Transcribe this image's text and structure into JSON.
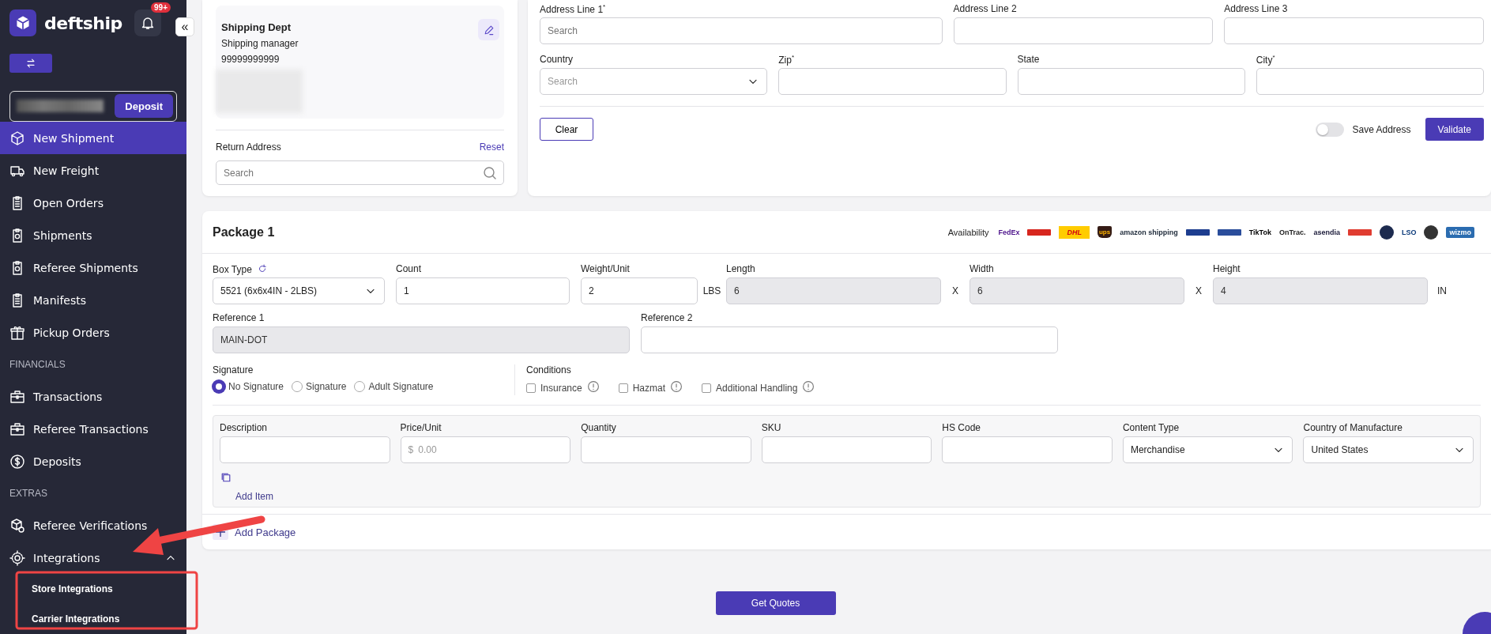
{
  "sidebar": {
    "brand": "deftship",
    "notification_count": "99+",
    "collapse_glyph": "«",
    "deposit_button": "Deposit",
    "sections": [
      {
        "items": [
          {
            "label": "New Shipment",
            "selected": true
          },
          {
            "label": "New Freight",
            "selected": false
          },
          {
            "label": "Open Orders",
            "selected": false
          },
          {
            "label": "Shipments",
            "selected": false
          },
          {
            "label": "Referee Shipments",
            "selected": false
          },
          {
            "label": "Manifests",
            "selected": false
          },
          {
            "label": "Pickup Orders",
            "selected": false
          }
        ]
      },
      {
        "heading": "FINANCIALS",
        "items": [
          {
            "label": "Transactions",
            "selected": false
          },
          {
            "label": "Referee Transactions",
            "selected": false
          },
          {
            "label": "Deposits",
            "selected": false
          }
        ]
      },
      {
        "heading": "EXTRAS",
        "items": [
          {
            "label": "Referee Verifications",
            "selected": false
          },
          {
            "label": "Integrations",
            "selected": false,
            "expanded": true,
            "children": [
              {
                "label": "Store Integrations",
                "selected": false
              },
              {
                "label": "Carrier Integrations",
                "selected": false
              }
            ]
          }
        ]
      }
    ]
  },
  "sender_card": {
    "name": "Shipping Dept",
    "title": "Shipping manager",
    "phone": "99999999999",
    "return_address_label": "Return Address",
    "reset_link": "Reset",
    "return_search_placeholder": "Search"
  },
  "address_form": {
    "address_lines": [
      {
        "label": "Address Line 1$^{*}$",
        "placeholder": "Search"
      },
      {
        "label": "Address Line 2"
      },
      {
        "label": "Address Line 3"
      }
    ],
    "location_fields": [
      {
        "label": "Country",
        "kind": "select",
        "placeholder": "Search"
      },
      {
        "label": "Zip$^{*}$",
        "kind": "text"
      },
      {
        "label": "State",
        "kind": "text"
      },
      {
        "label": "City$^{*}$",
        "kind": "text"
      }
    ],
    "clear_button": "Clear",
    "save_address": {
      "label": "Save Address",
      "on": false
    },
    "validate_button": "Validate"
  },
  "package": {
    "title": "Package 1",
    "availability_label": "Availability",
    "carriers": [
      {
        "kind": "wordmark",
        "label": "FedEx",
        "color": "#4d148c"
      },
      {
        "kind": "mark",
        "color": "#d7261e"
      },
      {
        "kind": "dhl",
        "label": "DHL",
        "color": "#ffcc00"
      },
      {
        "kind": "shield",
        "label": "ups",
        "color": "#351c15"
      },
      {
        "kind": "wordmark",
        "label": "amazon shipping",
        "color": "#232f3e"
      },
      {
        "kind": "mark",
        "color": "#1d3d8f"
      },
      {
        "kind": "mark",
        "color": "#2a4d9b"
      },
      {
        "kind": "wordmark",
        "label": "TikTok",
        "color": "#000000"
      },
      {
        "kind": "wordmark",
        "label": "OnTrac.",
        "color": "#222222"
      },
      {
        "kind": "wordmark",
        "label": "asendia",
        "color": "#1b1b3a"
      },
      {
        "kind": "mark",
        "color": "#e03c31"
      },
      {
        "kind": "circle",
        "color": "#1d2b4f"
      },
      {
        "kind": "wordmark",
        "label": "LSO",
        "color": "#0b3a7a"
      },
      {
        "kind": "circle",
        "color": "#333333"
      },
      {
        "kind": "badge",
        "label": "wizmo",
        "color": "#2b6cb0"
      }
    ],
    "row_1": [
      {
        "kind": "box-select",
        "label": "Box Type",
        "value": "5521 (6x6x4IN - 2LBS)"
      },
      {
        "kind": "text",
        "label": "Count",
        "value": "1",
        "disabled": false
      },
      {
        "kind": "text",
        "label": "Weight/Unit",
        "value": "2",
        "suffix": "LBS",
        "disabled": false
      },
      {
        "kind": "text",
        "label": "Length",
        "value": "6",
        "suffix": "X",
        "disabled": true
      },
      {
        "kind": "text",
        "label": "Width",
        "value": "6",
        "suffix": "X",
        "disabled": true
      },
      {
        "kind": "text",
        "label": "Height",
        "value": "4",
        "suffix": "IN",
        "disabled": true
      }
    ],
    "row_2": [
      {
        "label": "Reference 1",
        "value": "MAIN-DOT",
        "disabled": true
      },
      {
        "label": "Reference 2",
        "disabled": false
      }
    ],
    "signature": {
      "label": "Signature",
      "options": [
        {
          "label": "No Signature",
          "selected": true
        },
        {
          "label": "Signature",
          "selected": false
        },
        {
          "label": "Adult Signature",
          "selected": false
        }
      ]
    },
    "conditions": {
      "label": "Conditions",
      "options": [
        {
          "label": "Insurance",
          "checked": false
        },
        {
          "label": "Hazmat",
          "checked": false
        },
        {
          "label": "Additional Handling",
          "checked": false
        }
      ]
    },
    "items": {
      "columns": [
        {
          "label": "Description",
          "kind": "text"
        },
        {
          "label": "Price/Unit",
          "kind": "money",
          "prefix": "$",
          "placeholder": "0.00"
        },
        {
          "label": "Quantity",
          "kind": "text"
        },
        {
          "label": "SKU",
          "kind": "text"
        },
        {
          "label": "HS Code",
          "kind": "text"
        },
        {
          "label": "Content Type",
          "kind": "select",
          "value": "Merchandise"
        },
        {
          "label": "Country of Manufacture",
          "kind": "select",
          "value": "United States"
        }
      ],
      "add_item": "Add Item"
    },
    "add_package": "Add Package"
  },
  "get_quotes_button": "Get Quotes"
}
